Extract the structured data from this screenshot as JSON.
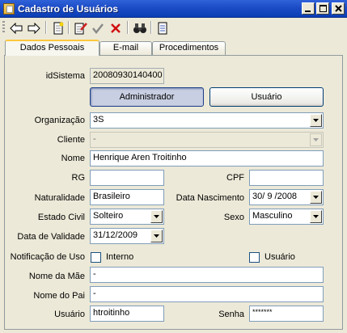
{
  "window": {
    "title": "Cadastro de Usuários"
  },
  "tabs": [
    {
      "label": "Dados Pessoais"
    },
    {
      "label": "E-mail"
    },
    {
      "label": "Procedimentos"
    }
  ],
  "form": {
    "idsistema": {
      "label": "idSistema",
      "value": "20080930140400"
    },
    "btn_admin": "Administrador",
    "btn_usuario": "Usuário",
    "organizacao": {
      "label": "Organização",
      "value": "3S"
    },
    "cliente": {
      "label": "Cliente",
      "value": "-"
    },
    "nome": {
      "label": "Nome",
      "value": "Henrique Aren Troitinho"
    },
    "rg": {
      "label": "RG",
      "value": ""
    },
    "cpf": {
      "label": "CPF",
      "value": ""
    },
    "naturalidade": {
      "label": "Naturalidade",
      "value": "Brasileiro"
    },
    "data_nascimento": {
      "label": "Data Nascimento",
      "value": "30/ 9 /2008"
    },
    "estado_civil": {
      "label": "Estado Civil",
      "value": "Solteiro"
    },
    "sexo": {
      "label": "Sexo",
      "value": "Masculino"
    },
    "data_validade": {
      "label": "Data de Validade",
      "value": "31/12/2009"
    },
    "notificacao": {
      "label": "Notificação de Uso",
      "interno": "Interno",
      "usuario": "Usuário"
    },
    "nome_mae": {
      "label": "Nome da Mãe",
      "value": "-"
    },
    "nome_pai": {
      "label": "Nome do Pai",
      "value": "-"
    },
    "usuario": {
      "label": "Usuário",
      "value": "htroitinho"
    },
    "senha": {
      "label": "Senha",
      "value": "*******"
    }
  }
}
